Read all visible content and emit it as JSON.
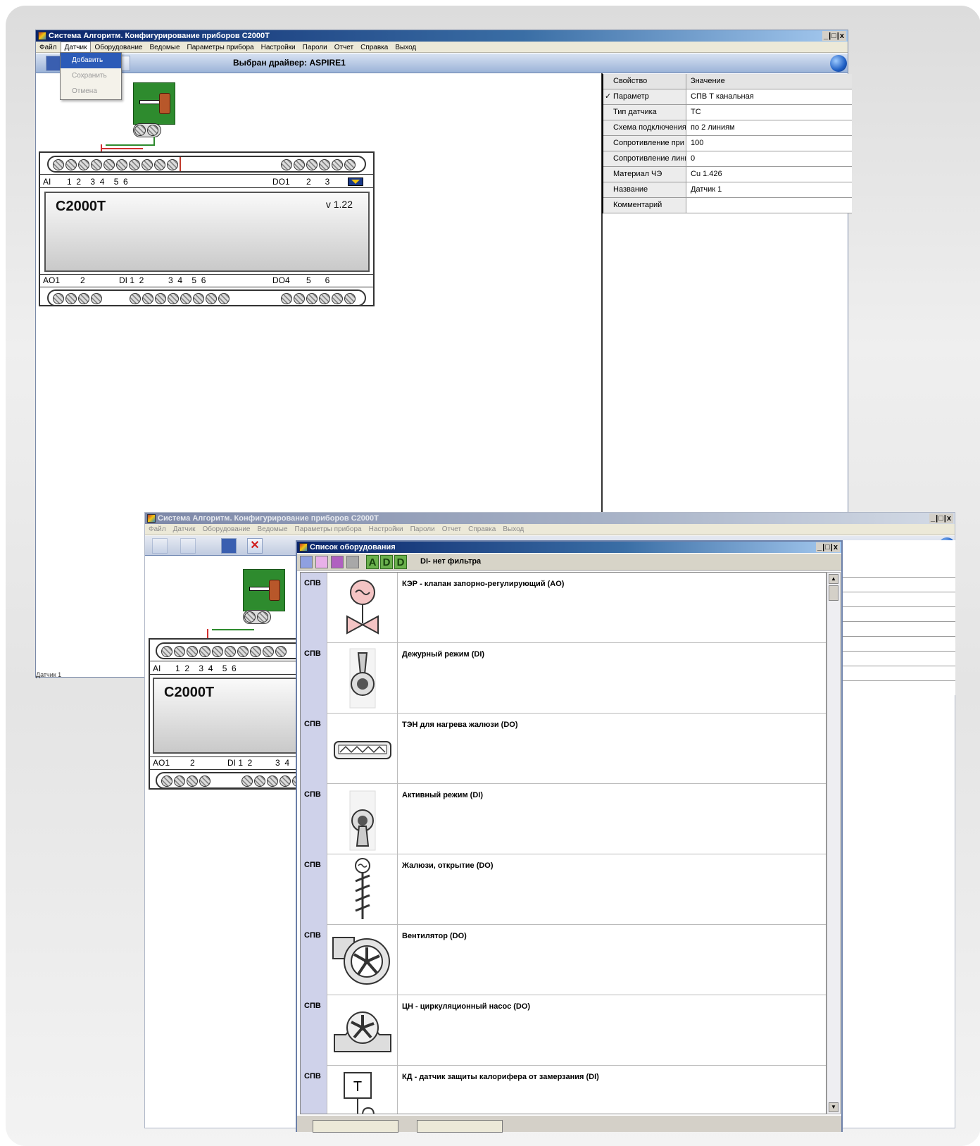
{
  "main_window": {
    "title": "Система Алгоритм. Конфигурирование приборов С2000Т",
    "controls": "_|□|x",
    "menu": [
      "Файл",
      "Датчик",
      "Оборудование",
      "Ведомые",
      "Параметры прибора",
      "Настройки",
      "Пароли",
      "Отчет",
      "Справка",
      "Выход"
    ],
    "toolbar_caption": "Выбран драйвер: ASPIRE1",
    "sensor_menu": [
      "Добавить",
      "Сохранить",
      "Отмена"
    ],
    "status_text": "Датчик 1"
  },
  "device": {
    "model": "C2000T",
    "version": "v 1.22",
    "top_labels": {
      "ai": "AI",
      "ai_pins": "1  2    3  4    5  6",
      "do1": "DO1",
      "do1_pins": "2      3"
    },
    "bottom_labels": {
      "ao1": "AO1",
      "ao1_pins": "2",
      "di": "DI 1  2",
      "di_pins": "3  4    5  6",
      "do4": "DO4",
      "do4_pins": "5      6"
    }
  },
  "properties": {
    "header": {
      "key": "Свойство",
      "value": "Значение"
    },
    "check_mark": "✓",
    "rows": [
      {
        "key": "Параметр",
        "value": "СПВ Т канальная",
        "checked": true
      },
      {
        "key": "Тип датчика",
        "value": "TC"
      },
      {
        "key": "Схема подключения",
        "value": "по 2 линиям"
      },
      {
        "key": "Сопротивление при",
        "value": "100"
      },
      {
        "key": "Сопротивление линии",
        "value": "0"
      },
      {
        "key": "Материал ЧЭ",
        "value": "Cu 1.426"
      },
      {
        "key": "Название",
        "value": "Датчик 1"
      },
      {
        "key": "Комментарий",
        "value": ""
      }
    ]
  },
  "second_window": {
    "title": "Система Алгоритм. Конфигурирование приборов С2000Т",
    "controls": "_|□|x",
    "menu": [
      "Файл",
      "Датчик",
      "Оборудование",
      "Ведомые",
      "Параметры прибора",
      "Настройки",
      "Пароли",
      "Отчет",
      "Справка",
      "Выход"
    ],
    "device": {
      "model": "C2000T",
      "top_labels": {
        "ai": "AI",
        "ai_pins": "1  2    3  4    5  6"
      },
      "bottom_labels": {
        "ao1": "AO1",
        "ao1_pins": "2",
        "di": "DI 1  2",
        "di_pins": "3  4"
      }
    }
  },
  "equipment_list": {
    "title": "Список оборудования",
    "controls": "_|□|x",
    "filter_letters": [
      "A",
      "D",
      "D"
    ],
    "filter_text": "DI- нет фильтра",
    "items": [
      {
        "category": "СПВ",
        "icon": "valve-icon",
        "name": "КЭР - клапан запорно-регулирующий (AO)"
      },
      {
        "category": "СПВ",
        "icon": "switch-icon",
        "name": "Дежурный режим (DI)"
      },
      {
        "category": "СПВ",
        "icon": "heater-icon",
        "name": "ТЭН для нагрева жалюзи (DO)"
      },
      {
        "category": "СПВ",
        "icon": "toggle-icon",
        "name": "Активный режим (DI)"
      },
      {
        "category": "СПВ",
        "icon": "louver-icon",
        "name": "Жалюзи, открытие (DO)"
      },
      {
        "category": "СПВ",
        "icon": "fan-icon",
        "name": "Вентилятор (DO)"
      },
      {
        "category": "СПВ",
        "icon": "pump-icon",
        "name": "ЦН - циркуляционный насос (DO)"
      },
      {
        "category": "СПВ",
        "icon": "thermostat-icon",
        "name": "КД - датчик защиты калорифера от замерзания (DI)"
      }
    ]
  },
  "colors": {
    "titlebar": "#0a246a",
    "sensor_green": "#2e8b2e",
    "filter_green": "#6ab04c",
    "category_bg": "#cfd2ea"
  }
}
